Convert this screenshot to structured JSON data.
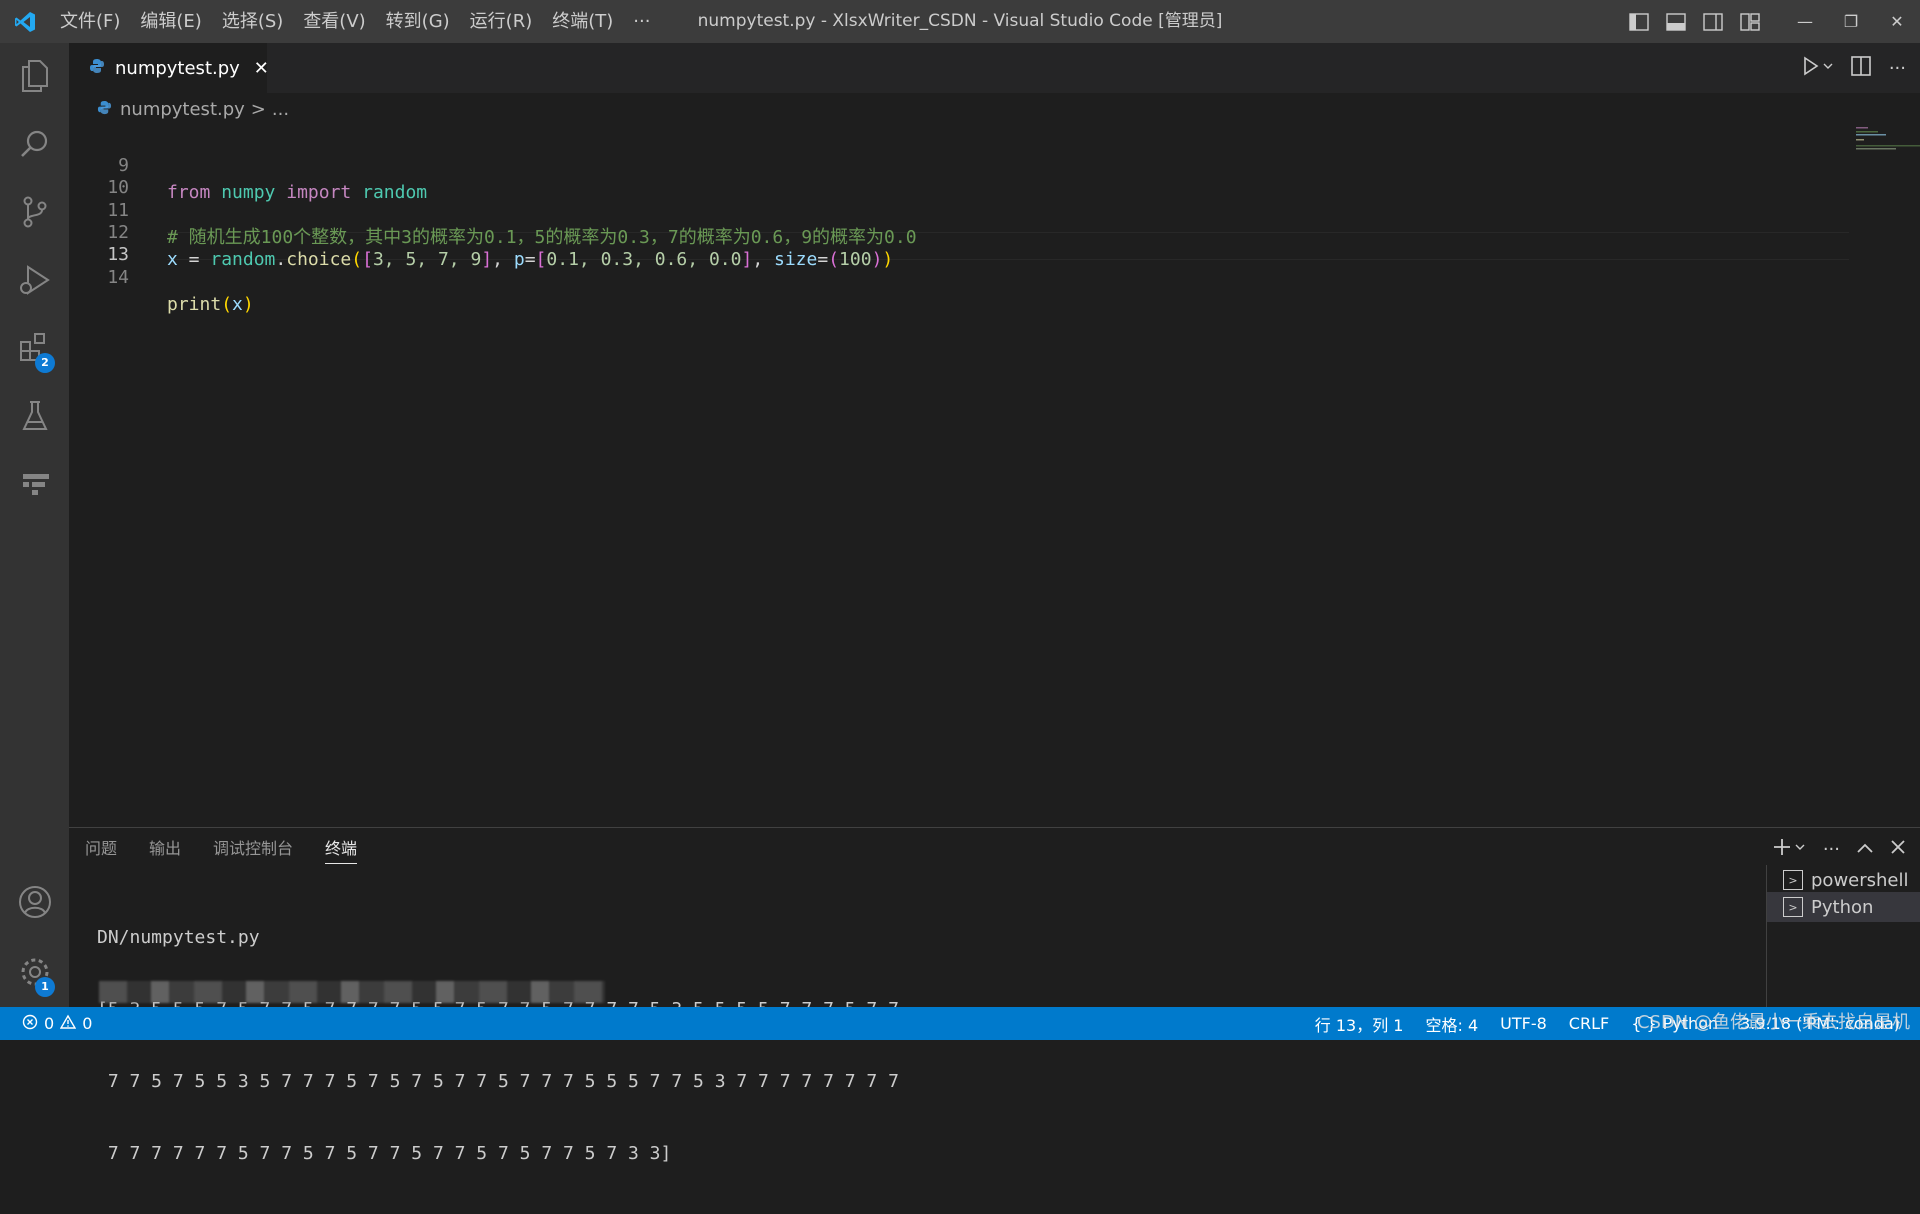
{
  "titlebar": {
    "menus": [
      "文件(F)",
      "编辑(E)",
      "选择(S)",
      "查看(V)",
      "转到(G)",
      "运行(R)",
      "终端(T)",
      "···"
    ],
    "title": "numpytest.py - XlsxWriter_CSDN - Visual Studio Code [管理员]"
  },
  "activitybar": {
    "items": [
      "explorer-icon",
      "search-icon",
      "source-control-icon",
      "run-debug-icon",
      "extensions-icon",
      "testing-icon",
      "pull-request-icon"
    ],
    "extensions_badge": "2",
    "settings_badge": "1"
  },
  "tab": {
    "label": "numpytest.py",
    "close": "✕"
  },
  "breadcrumb": {
    "file": "numpytest.py",
    "sep": ">",
    "more": "..."
  },
  "editor": {
    "active_line": "13",
    "lines": [
      {
        "n": "9"
      },
      {
        "n": "10"
      },
      {
        "n": "11"
      },
      {
        "n": "12"
      },
      {
        "n": "13"
      },
      {
        "n": "14"
      }
    ],
    "code": {
      "l9_from": "from",
      "l9_numpy": "numpy",
      "l9_import": "import",
      "l9_random": "random",
      "l11_comment": "# 随机生成100个整数，其中3的概率为0.1，5的概率为0.3，7的概率为0.6，9的概率为0.0",
      "l12_x": "x",
      "l12_eq": " = ",
      "l12_random": "random",
      "l12_dot": ".",
      "l12_choice": "choice",
      "l12_open": "(",
      "l12_lb": "[",
      "l12_list": "3, 5, 7, 9",
      "l12_rb": "]",
      "l12_comma1": ", ",
      "l12_p": "p",
      "l12_eq2": "=",
      "l12_lb2": "[",
      "l12_probs": "0.1, 0.3, 0.6, 0.0",
      "l12_rb2": "]",
      "l12_comma2": ", ",
      "l12_size": "size",
      "l12_eq3": "=",
      "l12_popen": "(",
      "l12_100": "100",
      "l12_pclose": ")",
      "l12_close": ")",
      "l14_print": "print",
      "l14_open": "(",
      "l14_x": "x",
      "l14_close": ")"
    }
  },
  "panel": {
    "tabs": [
      "问题",
      "输出",
      "调试控制台",
      "终端"
    ],
    "active_tab": "终端",
    "terminal_lines": [
      "DN/numpytest.py",
      "[5 3 5 5 5 7 5 7 7 5 7 7 7 7 5 5 7 5 7 7 5 7 7 7 7 5 3 5 5 5 5 7 7 7 5 7 7",
      " 7 7 5 7 5 5 3 5 7 7 7 5 7 5 7 5 7 7 5 7 7 7 5 5 5 7 7 5 3 7 7 7 7 7 7 7 7",
      " 7 7 7 7 7 7 5 7 7 5 7 5 7 7 5 7 7 5 7 5 7 7 5 7 3 3]"
    ],
    "terminals": [
      "powershell",
      "Python"
    ],
    "selected_terminal": "Python"
  },
  "statusbar": {
    "errors": "0",
    "warnings": "0",
    "position": "行 13，列 1",
    "spaces": "空格: 4",
    "encoding": "UTF-8",
    "eol": "CRLF",
    "language": "Python",
    "interpreter": "3.9.18 ('PM': conda)",
    "watermark": "CSDN @鱼佬最小一乘去找自是机"
  },
  "colors": {
    "accent": "#007acc",
    "titlebar": "#3c3c3c",
    "activitybar": "#333333",
    "editor_bg": "#1e1e1e"
  }
}
